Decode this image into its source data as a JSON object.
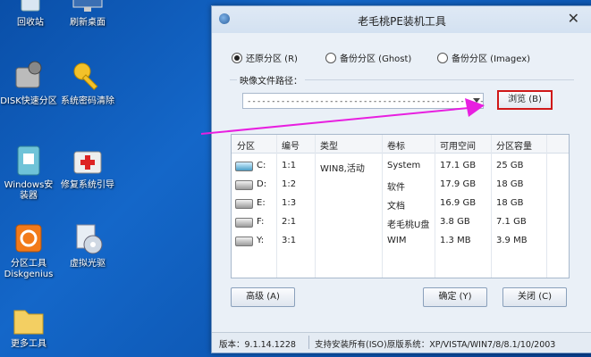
{
  "desktop": {
    "icons": [
      {
        "label": "回收站"
      },
      {
        "label": "刷新桌面"
      },
      {
        "label": "DISK快速分区"
      },
      {
        "label": "系统密码清除"
      },
      {
        "label": "Windows安装器"
      },
      {
        "label": "修复系统引导"
      },
      {
        "label": "分区工具Diskgenius"
      },
      {
        "label": "虚拟光驱"
      },
      {
        "label": "更多工具"
      }
    ]
  },
  "window": {
    "title": "老毛桃PE装机工具",
    "close_glyph": "✕",
    "modes": [
      {
        "label": "还原分区 (R)",
        "checked": true
      },
      {
        "label": "备份分区 (Ghost)",
        "checked": false
      },
      {
        "label": "备份分区 (Imagex)",
        "checked": false
      }
    ],
    "path_label": "映像文件路径：",
    "path_value": "------------------------------------------------------------",
    "browse_label": "浏览 (B)",
    "table": {
      "headers": [
        "分区",
        "编号",
        "类型",
        "卷标",
        "可用空间",
        "分区容量"
      ],
      "rows": [
        {
          "drive": "C:",
          "num": "1:1",
          "type": "WIN8,活动",
          "label": "System",
          "free": "17.1 GB",
          "size": "25 GB",
          "system": true
        },
        {
          "drive": "D:",
          "num": "1:2",
          "type": "",
          "label": "软件",
          "free": "17.9 GB",
          "size": "18 GB",
          "system": false
        },
        {
          "drive": "E:",
          "num": "1:3",
          "type": "",
          "label": "文档",
          "free": "16.9 GB",
          "size": "18 GB",
          "system": false
        },
        {
          "drive": "F:",
          "num": "2:1",
          "type": "",
          "label": "老毛桃U盘",
          "free": "3.8 GB",
          "size": "7.1 GB",
          "system": false
        },
        {
          "drive": "Y:",
          "num": "3:1",
          "type": "",
          "label": "WIM",
          "free": "1.3 MB",
          "size": "3.9 MB",
          "system": false
        }
      ]
    },
    "buttons": {
      "advanced": "高级 (A)",
      "ok": "确定 (Y)",
      "close": "关闭 (C)"
    },
    "status": {
      "version": "版本：9.1.14.1228",
      "support": "支持安装所有(ISO)原版系统：XP/VISTA/WIN7/8/8.1/10/2003"
    }
  }
}
